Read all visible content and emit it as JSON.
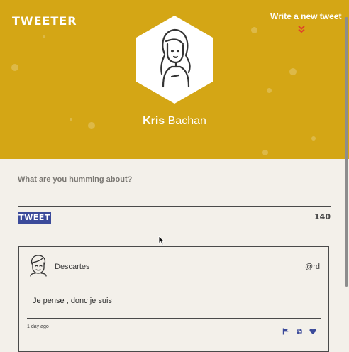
{
  "app": {
    "logo": "TWEETER"
  },
  "header": {
    "write_link": "Write a new tweet",
    "profile_first_name": "Kris",
    "profile_last_name": "Bachan",
    "accent_color": "#d4a615"
  },
  "compose": {
    "prompt": "What are you humming about?",
    "button_label": "TWEET",
    "char_count": "140",
    "button_color": "#3b4a9a"
  },
  "tweets": [
    {
      "name": "Descartes",
      "handle": "@rd",
      "text": "Je pense , donc je suis",
      "time": "1 day ago",
      "actions": [
        "flag-icon",
        "retweet-icon",
        "heart-icon"
      ]
    }
  ]
}
